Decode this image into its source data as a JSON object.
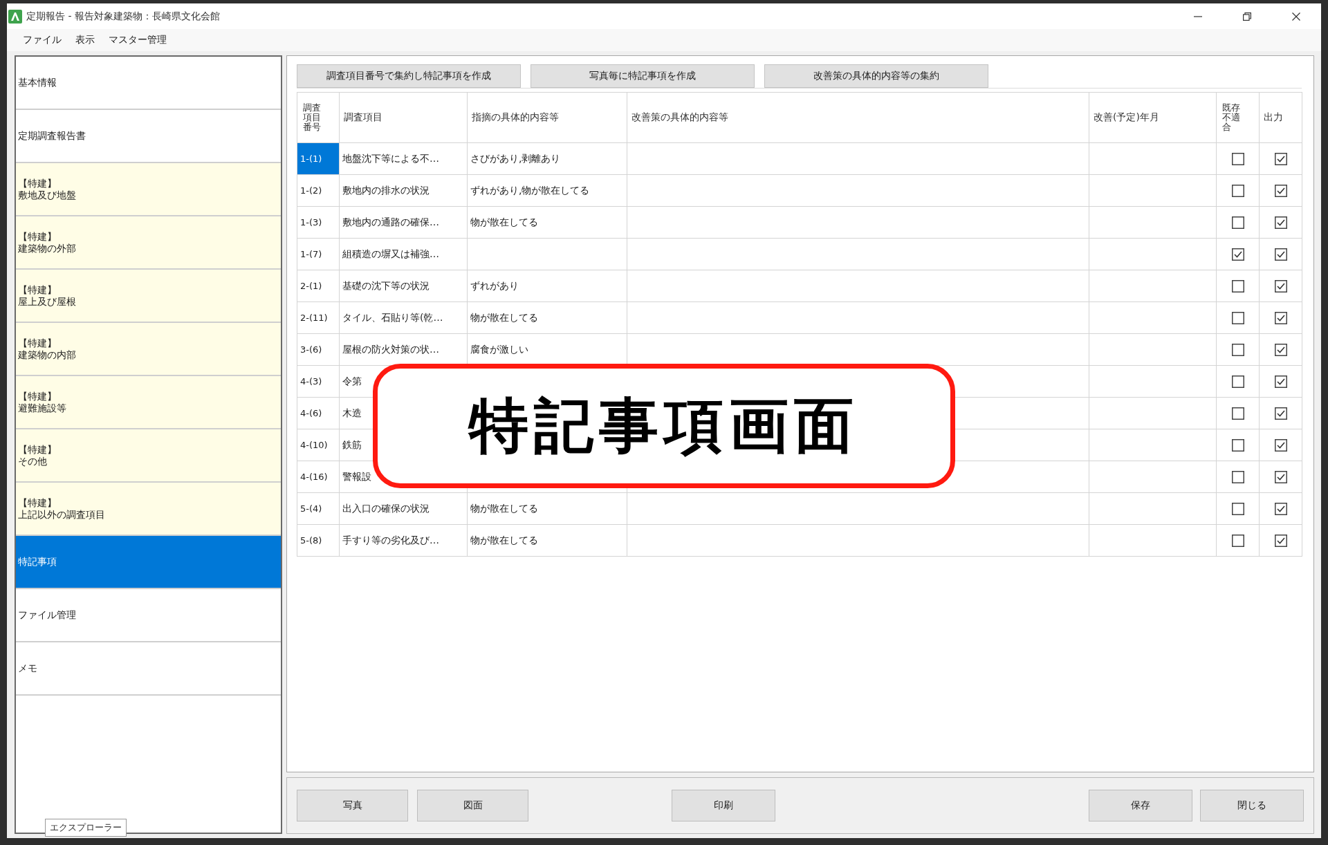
{
  "window": {
    "title": "定期報告 - 報告対象建築物：長崎県文化会館"
  },
  "menu": [
    "ファイル",
    "表示",
    "マスター管理"
  ],
  "sidebar": {
    "items": [
      {
        "kind": "page",
        "label": "基本情報",
        "selected": false
      },
      {
        "kind": "page",
        "label": "定期調査報告書",
        "selected": false
      },
      {
        "kind": "category",
        "prefix": "【特建】",
        "label": "敷地及び地盤",
        "selected": false
      },
      {
        "kind": "category",
        "prefix": "【特建】",
        "label": "建築物の外部",
        "selected": false
      },
      {
        "kind": "category",
        "prefix": "【特建】",
        "label": "屋上及び屋根",
        "selected": false
      },
      {
        "kind": "category",
        "prefix": "【特建】",
        "label": "建築物の内部",
        "selected": false
      },
      {
        "kind": "category",
        "prefix": "【特建】",
        "label": "避難施設等",
        "selected": false
      },
      {
        "kind": "category",
        "prefix": "【特建】",
        "label": "その他",
        "selected": false
      },
      {
        "kind": "category",
        "prefix": "【特建】",
        "label": "上記以外の調査項目",
        "selected": false
      },
      {
        "kind": "page",
        "label": "特記事項",
        "selected": true
      },
      {
        "kind": "page",
        "label": "ファイル管理",
        "selected": false
      },
      {
        "kind": "page",
        "label": "メモ",
        "selected": false
      }
    ],
    "footer_tab": "エクスプローラー"
  },
  "action_buttons": [
    "調査項目番号で集約し特記事項を作成",
    "写真毎に特記事項を作成",
    "改善策の具体的内容等の集約"
  ],
  "table": {
    "columns": [
      "調査項目番号",
      "調査項目",
      "指摘の具体的内容等",
      "改善策の具体的内容等",
      "改善(予定)年月",
      "既存不適合",
      "出力"
    ],
    "rows": [
      {
        "number": "1-(1)",
        "item": "地盤沈下等による不…",
        "finding": "さびがあり,剥離あり",
        "selected": true,
        "existing_nonconformity": false,
        "output": true
      },
      {
        "number": "1-(2)",
        "item": "敷地内の排水の状況",
        "finding": "ずれがあり,物が散在してる",
        "selected": false,
        "existing_nonconformity": false,
        "output": true
      },
      {
        "number": "1-(3)",
        "item": "敷地内の通路の確保…",
        "finding": "物が散在してる",
        "selected": false,
        "existing_nonconformity": false,
        "output": true
      },
      {
        "number": "1-(7)",
        "item": "組積造の塀又は補強…",
        "selected": false,
        "existing_nonconformity": true,
        "output": true
      },
      {
        "number": "2-(1)",
        "item": "基礎の沈下等の状況",
        "finding": "ずれがあり",
        "selected": false,
        "existing_nonconformity": false,
        "output": true
      },
      {
        "number": "2-(11)",
        "item": "タイル、石貼り等(乾…",
        "finding": "物が散在してる",
        "selected": false,
        "existing_nonconformity": false,
        "output": true
      },
      {
        "number": "3-(6)",
        "item": "屋根の防火対策の状…",
        "finding": "腐食が激しい",
        "selected": false,
        "existing_nonconformity": false,
        "output": true
      },
      {
        "number": "4-(3)",
        "item": "令第",
        "selected": false,
        "existing_nonconformity": false,
        "output": true
      },
      {
        "number": "4-(6)",
        "item": "木造",
        "selected": false,
        "existing_nonconformity": false,
        "output": true
      },
      {
        "number": "4-(10)",
        "item": "鉄筋",
        "selected": false,
        "existing_nonconformity": false,
        "output": true
      },
      {
        "number": "4-(16)",
        "item": "警報設",
        "selected": false,
        "existing_nonconformity": false,
        "output": true
      },
      {
        "number": "5-(4)",
        "item": "出入口の確保の状況",
        "finding": "物が散在してる",
        "selected": false,
        "existing_nonconformity": false,
        "output": true
      },
      {
        "number": "5-(8)",
        "item": "手すり等の劣化及び…",
        "finding": "物が散在してる",
        "selected": false,
        "existing_nonconformity": false,
        "output": true
      }
    ]
  },
  "footer": {
    "left_buttons": [
      "写真",
      "図面"
    ],
    "center_buttons": [
      "印刷"
    ],
    "right_buttons": [
      "保存",
      "閉じる"
    ]
  },
  "callout": {
    "text": "特記事項画面"
  }
}
